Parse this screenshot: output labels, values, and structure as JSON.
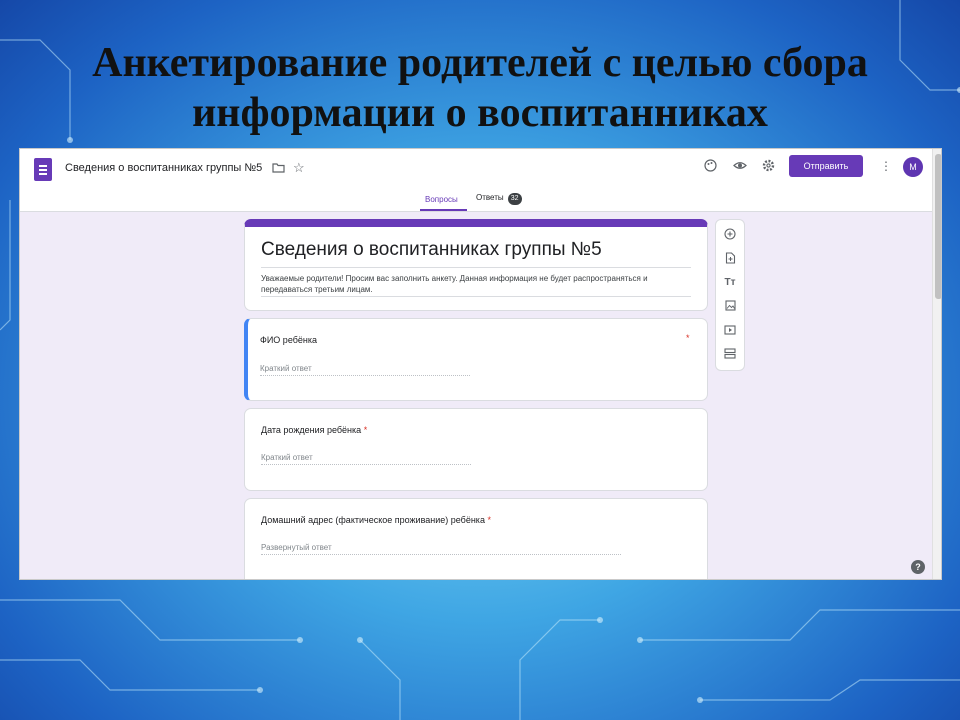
{
  "slide": {
    "title_line1": "Анкетирование родителей с целью сбора",
    "title_line2": "информации о воспитанниках"
  },
  "app": {
    "doc_title": "Сведения о воспитанниках группы №5",
    "send_label": "Отправить",
    "avatar_letter": "М",
    "icons": [
      "folder-icon",
      "star-icon",
      "palette-icon",
      "preview-eye-icon",
      "settings-gear-icon",
      "more-vert-icon"
    ]
  },
  "tabs": [
    {
      "label": "Вопросы",
      "active": true
    },
    {
      "label": "Ответы",
      "badge": "32",
      "active": false
    }
  ],
  "form": {
    "title": "Сведения о воспитанниках группы №5",
    "description": "Уважаемые родители! Просим вас заполнить анкету. Данная информация не будет распространяться и передаваться третьим лицам."
  },
  "questions": [
    {
      "title": "ФИО ребёнка",
      "required_mark": "*",
      "hint": "Краткий ответ"
    },
    {
      "title": "Дата рождения ребёнка",
      "required_mark": "*",
      "hint": "Краткий ответ"
    },
    {
      "title": "Домашний адрес (фактическое проживание) ребёнка",
      "required_mark": "*",
      "hint": "Развернутый ответ"
    }
  ],
  "side_tools": [
    "add-question-icon",
    "import-questions-icon",
    "add-title-icon",
    "add-image-icon",
    "add-video-icon",
    "add-section-icon"
  ],
  "help_label": "?"
}
